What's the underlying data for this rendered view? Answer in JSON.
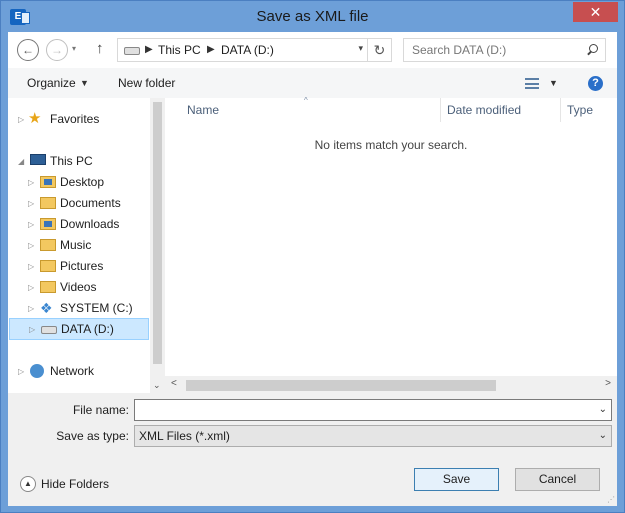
{
  "window": {
    "title": "Save as XML file",
    "app_icon": "E",
    "close": "✕"
  },
  "navbar": {
    "back": "←",
    "forward": "→",
    "history": "▾",
    "up": "↑",
    "breadcrumb": [
      "This PC",
      "DATA (D:)"
    ],
    "crumb_sep": "▶",
    "address_dropdown": "▾",
    "refresh": "↻",
    "search_placeholder": "Search DATA (D:)"
  },
  "toolbar": {
    "organize": "Organize",
    "new_folder": "New folder",
    "caret": "▼"
  },
  "nav_pane": {
    "favorites": "Favorites",
    "this_pc": "This PC",
    "items": [
      "Desktop",
      "Documents",
      "Downloads",
      "Music",
      "Pictures",
      "Videos",
      "SYSTEM (C:)",
      "DATA (D:)"
    ],
    "network": "Network",
    "collapsed": "▷",
    "expanded": "◢"
  },
  "file_pane": {
    "columns": [
      "Name",
      "Date modified",
      "Type"
    ],
    "sort_indicator": "^",
    "empty_message": "No items match your search."
  },
  "form": {
    "file_name_label": "File name:",
    "file_name_value": "",
    "save_type_label": "Save as type:",
    "save_type_value": "XML Files (*.xml)",
    "dropdown": "⌄"
  },
  "footer": {
    "hide_folders": "Hide Folders",
    "hide_icon": "▲",
    "save": "Save",
    "cancel": "Cancel"
  }
}
